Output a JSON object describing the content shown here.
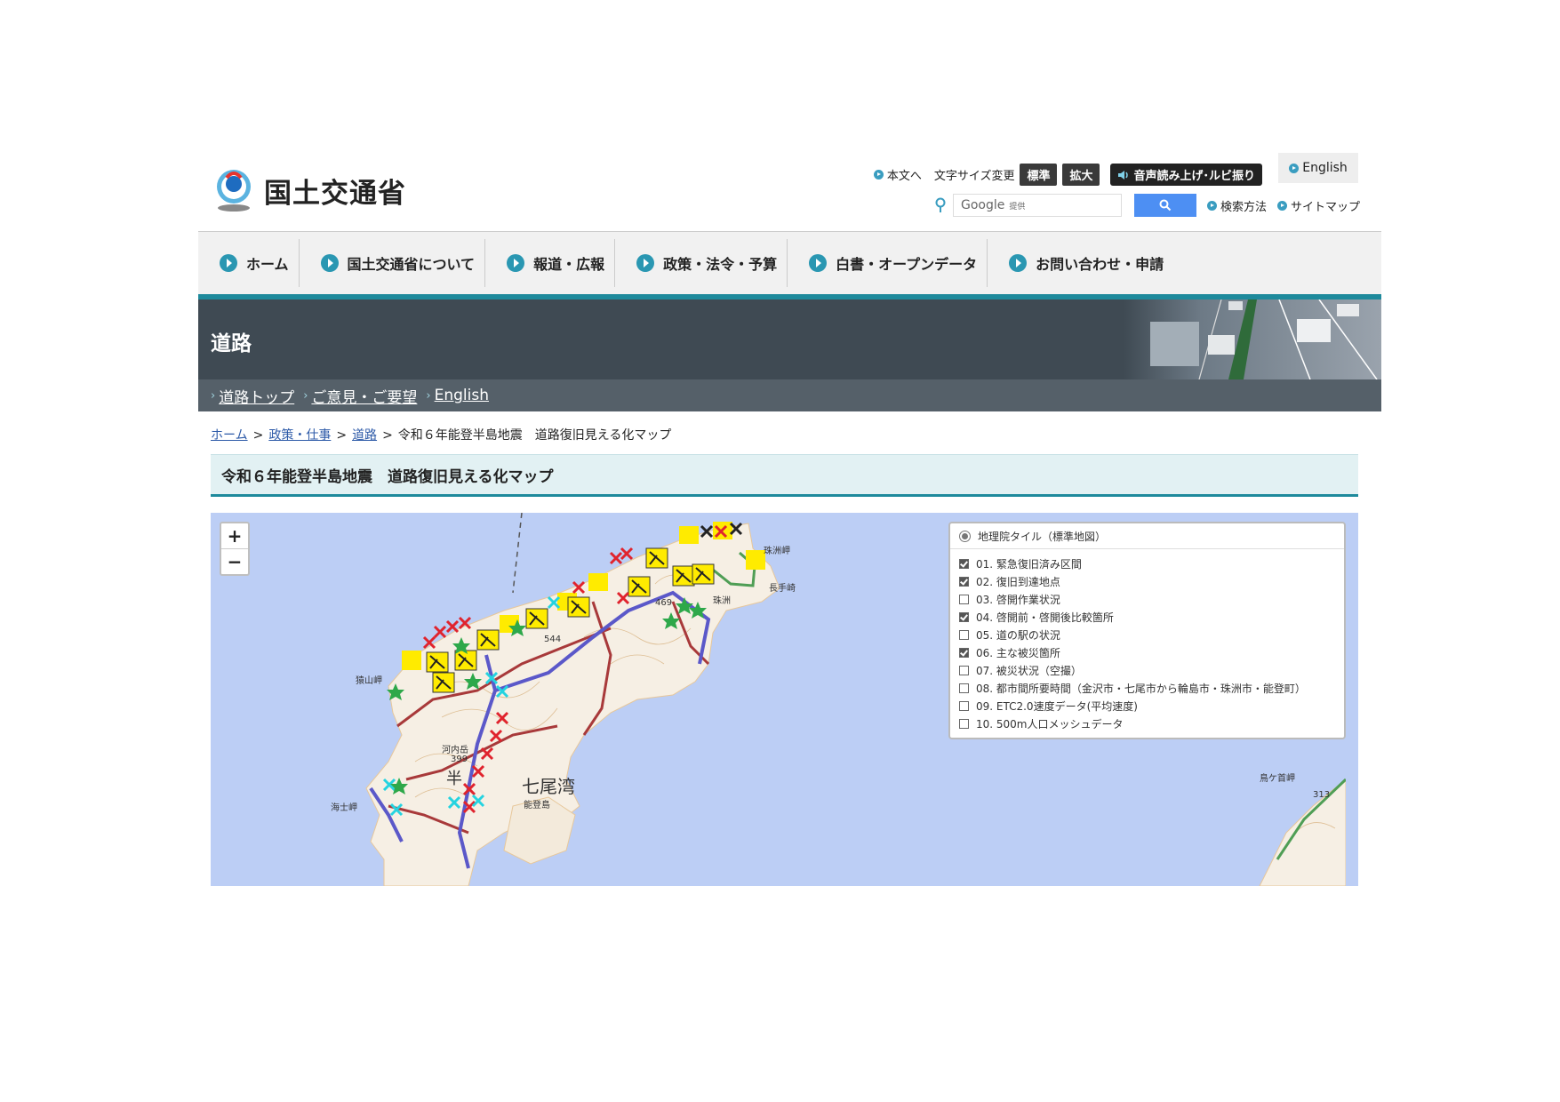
{
  "header": {
    "logo_text": "国土交通省",
    "skip_link": "本文へ",
    "font_size_label": "文字サイズ変更",
    "font_standard": "標準",
    "font_large": "拡大",
    "voice_button": "音声読み上げ･ルビ振り",
    "english_link": "English",
    "search_placeholder": "Google",
    "search_provided": "提供",
    "search_help": "検索方法",
    "sitemap": "サイトマップ"
  },
  "nav": {
    "items": [
      {
        "label": "ホーム"
      },
      {
        "label": "国土交通省について"
      },
      {
        "label": "報道・広報"
      },
      {
        "label": "政策・法令・予算"
      },
      {
        "label": "白書・オープンデータ"
      },
      {
        "label": "お問い合わせ・申請"
      }
    ]
  },
  "banner": {
    "title": "道路"
  },
  "subnav": {
    "items": [
      {
        "label": "道路トップ"
      },
      {
        "label": "ご意見・ご要望"
      },
      {
        "label": "English"
      }
    ]
  },
  "breadcrumb": {
    "home": "ホーム",
    "policy": "政策・仕事",
    "road": "道路",
    "current": "令和６年能登半島地震　道路復旧見える化マップ"
  },
  "page_title": "令和６年能登半島地震　道路復旧見える化マップ",
  "map": {
    "zoom_in": "+",
    "zoom_out": "−",
    "base_layer": "地理院タイル（標準地図）",
    "layers": [
      {
        "label": "01. 緊急復旧済み区間",
        "checked": true
      },
      {
        "label": "02. 復旧到達地点",
        "checked": true
      },
      {
        "label": "03. 啓開作業状況",
        "checked": false
      },
      {
        "label": "04. 啓開前・啓開後比較箇所",
        "checked": true
      },
      {
        "label": "05. 道の駅の状況",
        "checked": false
      },
      {
        "label": "06. 主な被災箇所",
        "checked": true
      },
      {
        "label": "07. 被災状況（空撮）",
        "checked": false
      },
      {
        "label": "08. 都市間所要時間（金沢市・七尾市から輪島市・珠洲市・能登町）",
        "checked": false
      },
      {
        "label": "09. ETC2.0速度データ(平均速度)",
        "checked": false
      },
      {
        "label": "10. 500m人口メッシュデータ",
        "checked": false
      }
    ],
    "places": {
      "suzu_cape": "珠洲岬",
      "nagate_cape": "長手崎",
      "suzu": "珠洲",
      "saruyama": "猿山岬",
      "kawachi": "河内岳",
      "umishi": "海士岬",
      "nanao_bay": "七尾湾",
      "notojima": "能登島",
      "torigakubi": "鳥ケ首岬",
      "peninsula": "半",
      "elev_469": "469",
      "elev_544": "544",
      "elev_399": "399",
      "elev_313": "313"
    }
  }
}
